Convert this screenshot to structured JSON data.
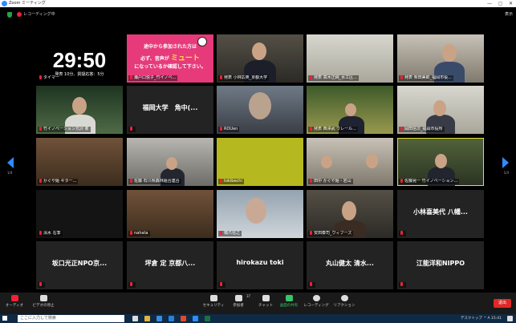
{
  "window": {
    "title": "Zoom ミーティング",
    "minimize": "—",
    "restore": "◻",
    "close": "✕"
  },
  "status": {
    "recording": "レコーディング中",
    "view": "表示"
  },
  "pages": {
    "left": "1/4",
    "right": "1/4"
  },
  "tiles": [
    {
      "type": "timer",
      "timer": "29:50",
      "sub": "発表 10分、質疑応答：5分",
      "name": "タイマー"
    },
    {
      "type": "notice",
      "line1": "途中から参加された方は",
      "line2": "必ず、音声が",
      "mute": "ミュート",
      "line3": "になっているか確認して下さい。",
      "name": "瀬戸口悦子_竹イノベ..."
    },
    {
      "type": "video",
      "name": "発表 小林広英_京都大学"
    },
    {
      "type": "video",
      "name": "発表 高木正純_水工区..."
    },
    {
      "type": "video",
      "name": "発表 柴田美郎_福岡市役..."
    },
    {
      "type": "video",
      "name": "竹イノベーション元沢 孝"
    },
    {
      "type": "text",
      "center": "福岡大学　角中(...",
      "name": ""
    },
    {
      "type": "video",
      "name": "ROUen"
    },
    {
      "type": "video",
      "name": "発表 西澤武 ウレール..."
    },
    {
      "type": "video",
      "name": "岡田信次_福岡市役所"
    },
    {
      "type": "video",
      "name": "かぐや姫 ギター..."
    },
    {
      "type": "video",
      "name": "佐藤 石川県森林組合連合"
    },
    {
      "type": "video",
      "name": "tokibechi"
    },
    {
      "type": "video",
      "name": "田中 かぐや姫・岩山"
    },
    {
      "type": "video",
      "name": "佐藤晃一 竹イノベーション..."
    },
    {
      "type": "dark",
      "name": "清水 右季"
    },
    {
      "type": "video",
      "name": "nahata"
    },
    {
      "type": "video",
      "name": "橋爪信之"
    },
    {
      "type": "video",
      "name": "安田泰司_ヴィフーズ"
    },
    {
      "type": "text",
      "center": "小林喜美代 八幡...",
      "name": ""
    },
    {
      "type": "text",
      "center": "坂口光正NPO京...",
      "name": ""
    },
    {
      "type": "text",
      "center": "坪倉 定 京都八...",
      "name": ""
    },
    {
      "type": "text",
      "center": "hirokazu toki",
      "name": ""
    },
    {
      "type": "text",
      "center": "丸山健太 清水...",
      "name": ""
    },
    {
      "type": "text",
      "center": "江能洋和NIPPO",
      "name": ""
    }
  ],
  "toolbar": {
    "audio": "オーディオ",
    "video": "ビデオの停止",
    "security": "セキュリティ",
    "participants": "参加者",
    "participants_count": "37",
    "chat": "チャット",
    "share": "画面の共有",
    "record": "レコーディング",
    "reactions": "リアクション",
    "end": "退出"
  },
  "taskbar": {
    "search": "ここに入力して検索",
    "tray": "デスクトップ  ^  A  15:41"
  }
}
